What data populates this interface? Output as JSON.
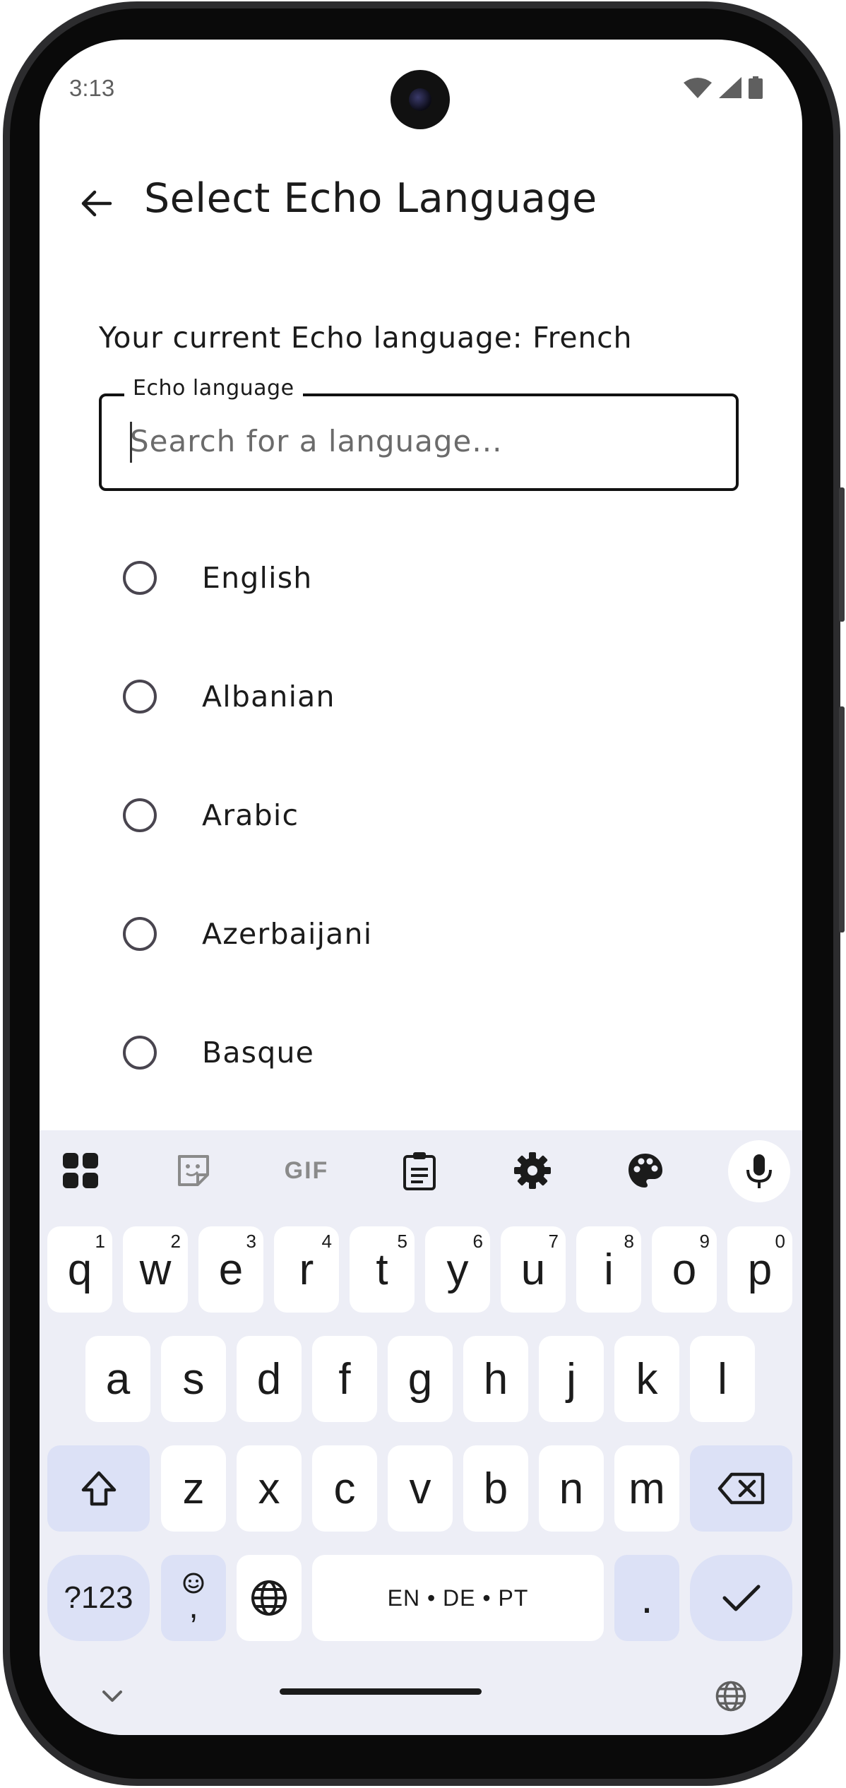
{
  "status_bar": {
    "time": "3:13",
    "icons": [
      "wifi-icon",
      "signal-icon",
      "battery-icon"
    ]
  },
  "app_bar": {
    "back_icon": "arrow-back-icon",
    "title": "Select Echo Language"
  },
  "current_language_text": "Your current Echo language: French",
  "search": {
    "label": "Echo language",
    "placeholder": "Search for a language...",
    "value": ""
  },
  "languages": [
    {
      "label": "English",
      "selected": false
    },
    {
      "label": "Albanian",
      "selected": false
    },
    {
      "label": "Arabic",
      "selected": false
    },
    {
      "label": "Azerbaijani",
      "selected": false
    },
    {
      "label": "Basque",
      "selected": false
    }
  ],
  "keyboard": {
    "toolbar": [
      "apps-grid-icon",
      "sticker-icon",
      "gif-icon",
      "clipboard-icon",
      "settings-gear-icon",
      "palette-icon",
      "microphone-icon"
    ],
    "gif_label": "GIF",
    "row1": [
      {
        "key": "q",
        "hint": "1"
      },
      {
        "key": "w",
        "hint": "2"
      },
      {
        "key": "e",
        "hint": "3"
      },
      {
        "key": "r",
        "hint": "4"
      },
      {
        "key": "t",
        "hint": "5"
      },
      {
        "key": "y",
        "hint": "6"
      },
      {
        "key": "u",
        "hint": "7"
      },
      {
        "key": "i",
        "hint": "8"
      },
      {
        "key": "o",
        "hint": "9"
      },
      {
        "key": "p",
        "hint": "0"
      }
    ],
    "row2": [
      "a",
      "s",
      "d",
      "f",
      "g",
      "h",
      "j",
      "k",
      "l"
    ],
    "row3": [
      "z",
      "x",
      "c",
      "v",
      "b",
      "n",
      "m"
    ],
    "symbols_label": "?123",
    "comma_label": ",",
    "space_label": "EN • DE • PT",
    "period_label": ".",
    "accent_color": "#dce1f6",
    "background_color": "#edeef6"
  }
}
